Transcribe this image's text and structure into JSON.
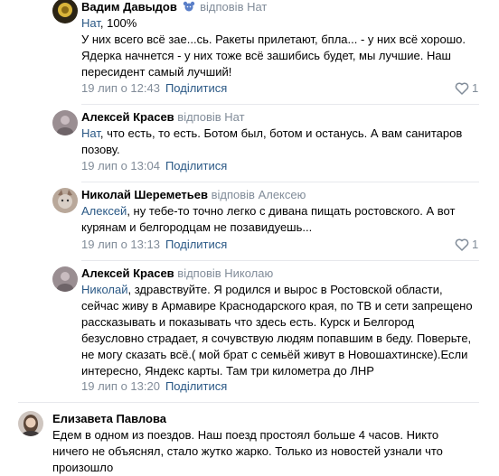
{
  "comments": [
    {
      "author": "Вадим Давыдов",
      "reply_to": "відповів Нат",
      "mention": "Нат",
      "text": ", 100%\nУ них всего всё зае...сь. Ракеты прилетают, бпла... - у них всё хорошо. Ядерка начнется - у них тоже всё зашибись будет, мы лучшие. Наш пересидент самый лучший!",
      "date": "19 лип о 12:43",
      "share": "Поділитися",
      "likes": "1"
    },
    {
      "author": "Алексей Красев",
      "reply_to": "відповів Нат",
      "mention": "Нат",
      "text": ", что есть, то есть. Ботом был, ботом и останусь. А вам санитаров позову.",
      "date": "19 лип о 13:04",
      "share": "Поділитися"
    },
    {
      "author": "Николай Шереметьев",
      "reply_to": "відповів Алексею",
      "mention": "Алексей",
      "text": ", ну тебе-то точно легко с дивана пищать ростовского. А вот курянам и белгородцам не позавидуешь...",
      "date": "19 лип о 13:13",
      "share": "Поділитися",
      "likes": "1"
    },
    {
      "author": "Алексей Красев",
      "reply_to": "відповів Николаю",
      "mention": "Николай",
      "text": ", здравствуйте. Я родился и вырос в Ростовской области, сейчас живу в Армавире Краснодарского края, по ТВ и сети запрещено рассказывать и показывать что здесь есть. Курск и Белгород безусловно страдает, я сочувствую людям попавшим в беду. Поверьте, не могу сказать всё.( мой брат с семьёй живут в Новошахтинске).Если интересно, Яндекс карты. Там три километра до ЛНР",
      "date": "19 лип о 13:20",
      "share": "Поділитися"
    },
    {
      "author": "Елизавета Павлова",
      "text": "Едем в одном из поездов. Наш поезд простоял больше 4 часов. Никто ничего не объяснял, стало жутко жарко. Только из новостей узнали что произошло"
    }
  ],
  "icons": {
    "badge": "bear-badge-icon",
    "like": "heart-icon"
  },
  "colors": {
    "link": "#2a5885",
    "muted": "#818c99",
    "divider": "#e7e8ec"
  }
}
